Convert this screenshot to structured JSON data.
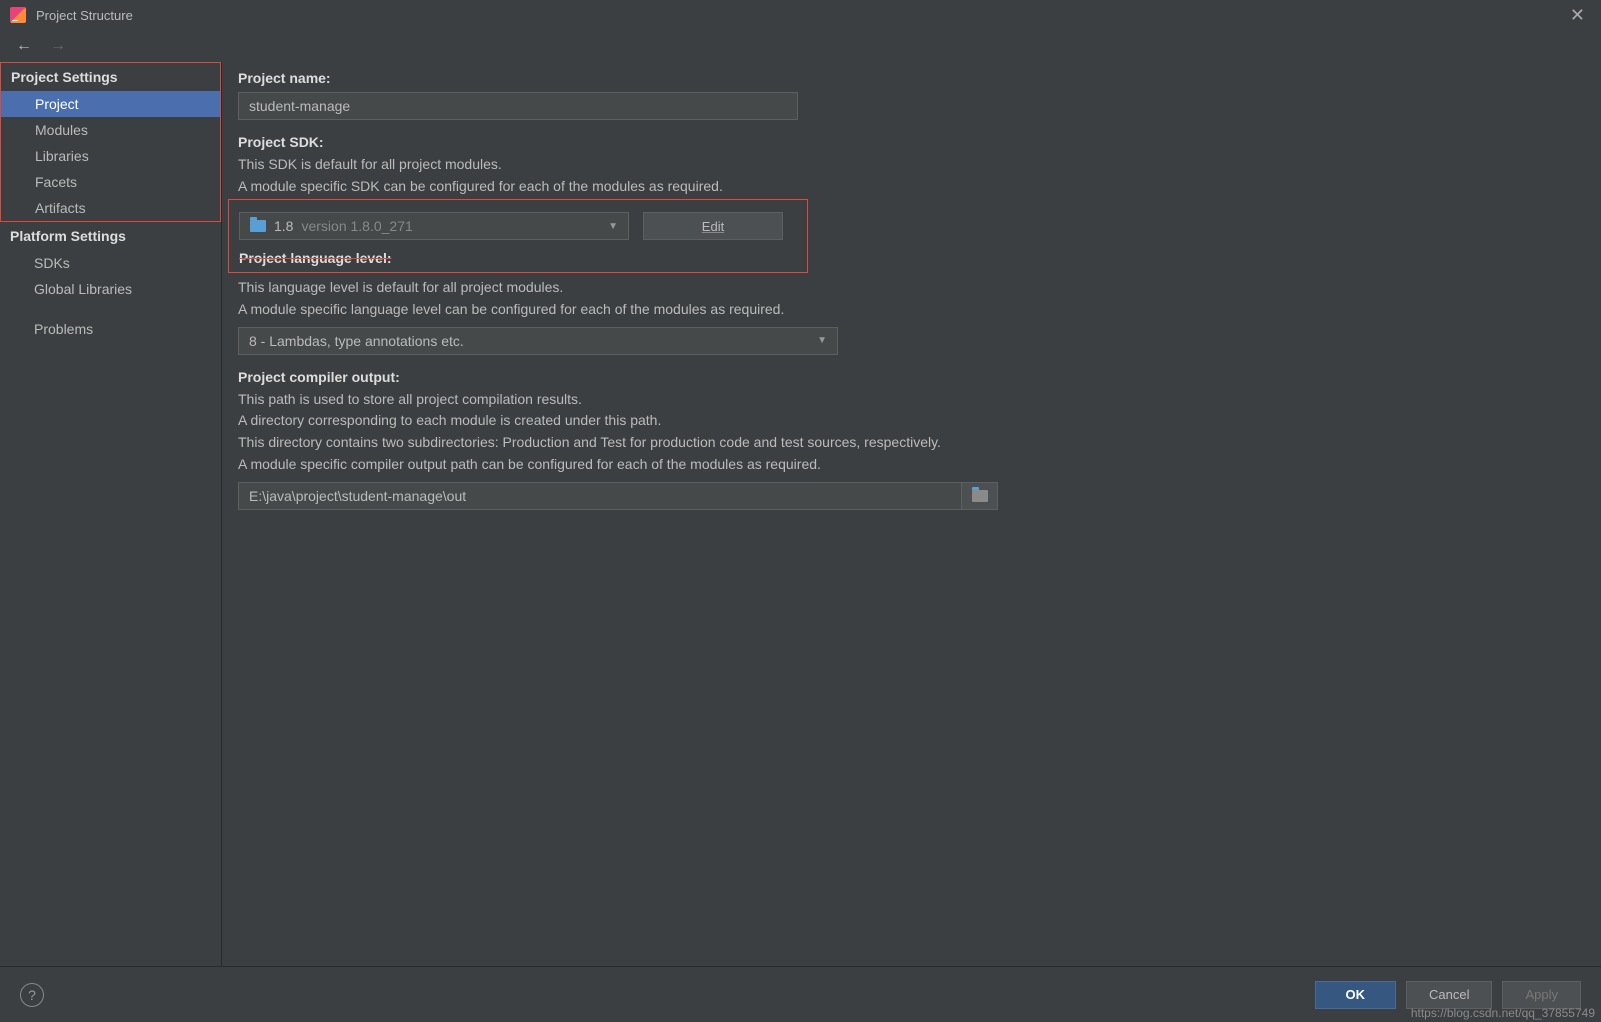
{
  "title": "Project Structure",
  "sidebar": {
    "section1": "Project Settings",
    "items1": {
      "project": "Project",
      "modules": "Modules",
      "libraries": "Libraries",
      "facets": "Facets",
      "artifacts": "Artifacts"
    },
    "section2": "Platform Settings",
    "items2": {
      "sdks": "SDKs",
      "global": "Global Libraries"
    },
    "problems": "Problems"
  },
  "projectName": {
    "label": "Project name:",
    "value": "student-manage"
  },
  "sdk": {
    "label": "Project SDK:",
    "desc1": "This SDK is default for all project modules.",
    "desc2": "A module specific SDK can be configured for each of the modules as required.",
    "name": "1.8",
    "version": "version 1.8.0_271",
    "edit": "Edit"
  },
  "lang": {
    "label": "Project language level:",
    "desc1": "This language level is default for all project modules.",
    "desc2": "A module specific language level can be configured for each of the modules as required.",
    "value": "8 - Lambdas, type annotations etc."
  },
  "compiler": {
    "label": "Project compiler output:",
    "desc1": "This path is used to store all project compilation results.",
    "desc2": "A directory corresponding to each module is created under this path.",
    "desc3": "This directory contains two subdirectories: Production and Test for production code and test sources, respectively.",
    "desc4": "A module specific compiler output path can be configured for each of the modules as required.",
    "value": "E:\\java\\project\\student-manage\\out"
  },
  "footer": {
    "ok": "OK",
    "cancel": "Cancel",
    "apply": "Apply",
    "help": "?"
  },
  "watermark": "https://blog.csdn.net/qq_37855749"
}
